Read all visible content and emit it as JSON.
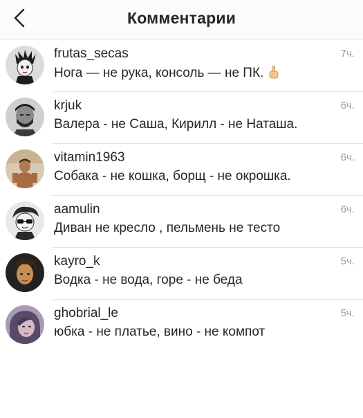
{
  "header": {
    "title": "Комментарии",
    "back_icon": "chevron-left-icon"
  },
  "comments": [
    {
      "username": "frutas_secas",
      "text": "Нога — не рука, консоль — не ПК.",
      "emoji": "hand-pointing-up-icon",
      "time": "7ч."
    },
    {
      "username": "krjuk",
      "text": "Валера - не Саша, Кирилл - не Наташа.",
      "time": "6ч."
    },
    {
      "username": "vitamin1963",
      "text": "Собака - не кошка, борщ - не окрошка.",
      "time": "6ч."
    },
    {
      "username": "aamulin",
      "text": "Диван не кресло , пельмень не тесто",
      "time": "6ч."
    },
    {
      "username": "kayro_k",
      "text": "Водка - не вода, горе - не беда",
      "time": "5ч."
    },
    {
      "username": "ghobrial_le",
      "text": "юбка - не платье, вино - не компот",
      "time": "5ч."
    }
  ],
  "colors": {
    "text": "#262626",
    "timestamp": "#9a9a9a",
    "divider": "#e2e2e2"
  }
}
